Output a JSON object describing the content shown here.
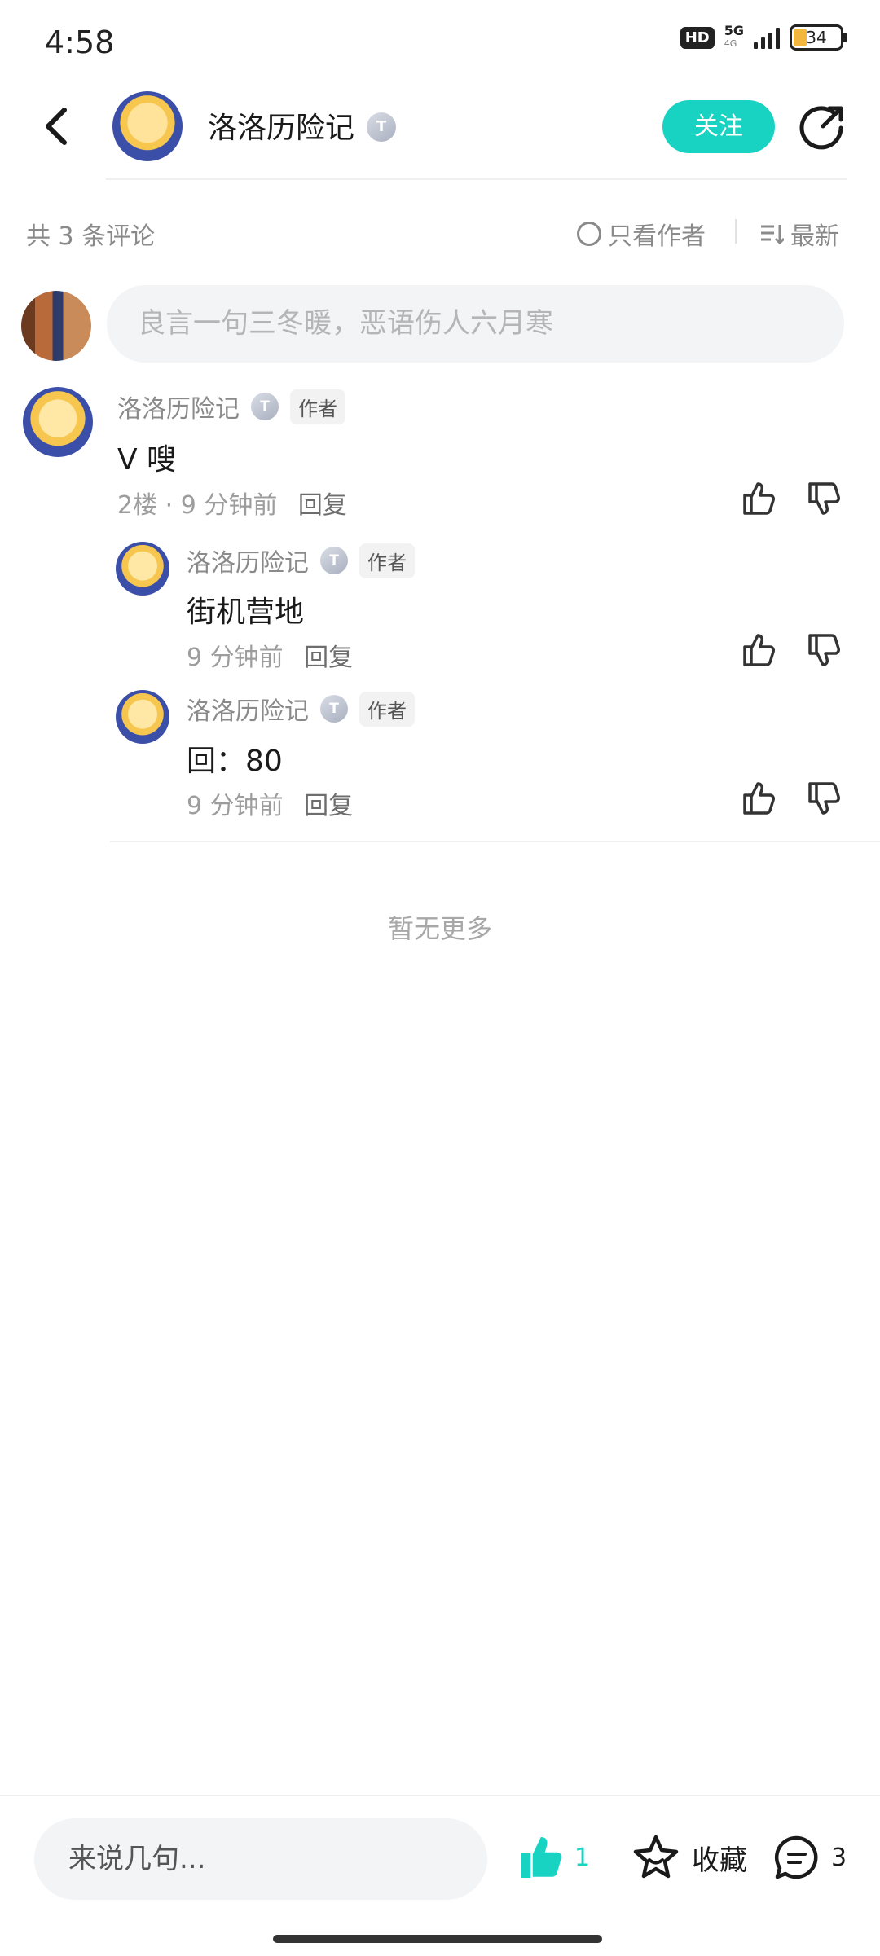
{
  "status_bar": {
    "time": "4:58",
    "hd_label": "HD",
    "network": "5G",
    "network_sub": "4G",
    "battery": "34"
  },
  "header": {
    "back_icon": "back-arrow-icon",
    "username": "洛洛历险记",
    "badge_letter": "T",
    "follow_label": "关注",
    "share_icon": "share-icon"
  },
  "toolbar": {
    "comment_count": "共 3 条评论",
    "only_author_label": "只看作者",
    "sort_label": "最新"
  },
  "top_input": {
    "placeholder": "良言一句三冬暖，恶语伤人六月寒"
  },
  "comments": [
    {
      "author": "洛洛历险记",
      "badge_letter": "T",
      "author_tag": "作者",
      "text": "V 嗖",
      "meta": "2楼 · 9 分钟前",
      "reply_label": "回复"
    },
    {
      "author": "洛洛历险记",
      "badge_letter": "T",
      "author_tag": "作者",
      "text": "街机营地",
      "meta": "9 分钟前",
      "reply_label": "回复"
    },
    {
      "author": "洛洛历险记",
      "badge_letter": "T",
      "author_tag": "作者",
      "text": "回：80",
      "meta": "9 分钟前",
      "reply_label": "回复"
    }
  ],
  "no_more": "暂无更多",
  "bottom_bar": {
    "input_placeholder": "来说几句...",
    "like_count": "1",
    "favorite_label": "收藏",
    "comment_count": "3"
  },
  "colors": {
    "accent": "#19d3c2",
    "muted_text": "#8a8a8a",
    "input_bg": "#f3f4f6"
  }
}
